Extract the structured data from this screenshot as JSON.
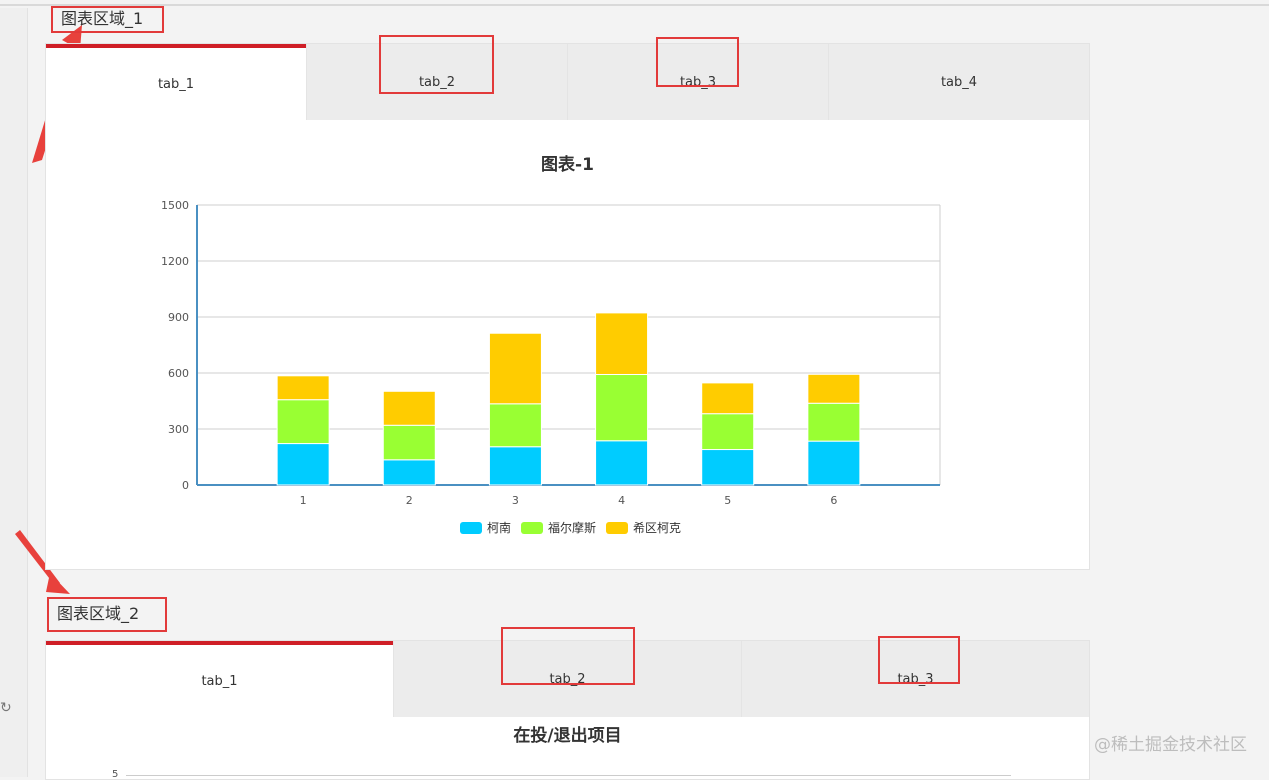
{
  "region1": {
    "title": "图表区域_1",
    "tabs": [
      {
        "label": "tab_1",
        "active": true
      },
      {
        "label": "tab_2",
        "active": false
      },
      {
        "label": "tab_3",
        "active": false
      },
      {
        "label": "tab_4",
        "active": false
      }
    ]
  },
  "region2": {
    "title": "图表区域_2",
    "tabs": [
      {
        "label": "tab_1",
        "active": true
      },
      {
        "label": "tab_2",
        "active": false
      },
      {
        "label": "tab_3",
        "active": false
      }
    ],
    "chart_title": "在投/退出项目",
    "partial_tick": "5"
  },
  "chart_data": {
    "type": "bar",
    "stacked": true,
    "title": "图表-1",
    "categories": [
      "1",
      "2",
      "3",
      "4",
      "5",
      "6"
    ],
    "series": [
      {
        "name": "柯南",
        "color": "#00ccff",
        "values": [
          222,
          135,
          205,
          237,
          190,
          235
        ]
      },
      {
        "name": "福尔摩斯",
        "color": "#99ff33",
        "values": [
          235,
          185,
          230,
          355,
          192,
          203
        ]
      },
      {
        "name": "希区柯克",
        "color": "#ffcc00",
        "values": [
          128,
          182,
          378,
          330,
          165,
          155
        ]
      }
    ],
    "ylim": [
      0,
      1500
    ],
    "yticks": [
      0,
      300,
      600,
      900,
      1200,
      1500
    ],
    "grid": true,
    "legend_position": "bottom"
  },
  "colors": {
    "accent_red": "#cf1e26",
    "annotation_red": "#e23a3a",
    "axis_blue": "#4a90c2"
  },
  "watermark": "@稀土掘金技术社区"
}
